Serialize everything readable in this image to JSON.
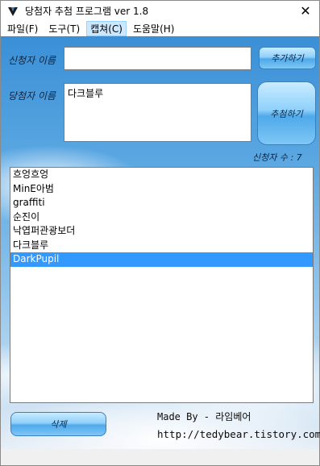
{
  "window": {
    "title": "당첨자 추첨 프로그램 ver 1.8",
    "close_glyph": "✕"
  },
  "menu": [
    {
      "label": "파일(F)",
      "active": false
    },
    {
      "label": "도구(T)",
      "active": false
    },
    {
      "label": "캡쳐(C)",
      "active": true
    },
    {
      "label": "도움말(H)",
      "active": false
    }
  ],
  "applicant": {
    "label": "신청자 이름",
    "value": "",
    "add_button": "추가하기"
  },
  "winner": {
    "label": "당첨자 이름",
    "value": "다크블루",
    "draw_button": "추첨하기"
  },
  "count": {
    "text": "신청자 수 : 7"
  },
  "applicants": [
    "흐엉흐엉",
    "MinE아범",
    "graffiti",
    "순진이",
    "낙엽퍼관광보더",
    "다크블루",
    "DarkPupil"
  ],
  "selected_index": 6,
  "footer": {
    "delete_button": "삭제",
    "made_by": "Made By - 라임베어",
    "url": "http://tedybear.tistory.com"
  },
  "colors": {
    "selection": "#3399ff",
    "menu_active": "#cce8ff",
    "sky_top": "#3a8fd6",
    "sky_bottom": "#e6eef6"
  },
  "icons": {
    "app": "app-icon",
    "close": "close-icon"
  }
}
